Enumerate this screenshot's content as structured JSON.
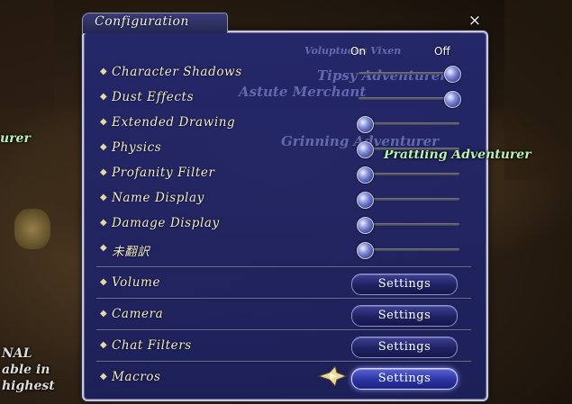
{
  "window": {
    "title": "Configuration",
    "close_glyph": "×"
  },
  "columns": {
    "on": "On",
    "off": "Off"
  },
  "background_text": {
    "green_left": "urer",
    "green_right": "Prattling Adventurer",
    "white_lines": [
      "NAL",
      "able in",
      "highest"
    ],
    "ghost_names": [
      "Voluptuous Vixen",
      "Tipsy Adventurer",
      "Astute Merchant",
      "Grinning Adventurer"
    ]
  },
  "toggles": [
    {
      "label": "Character Shadows",
      "value": "Off"
    },
    {
      "label": "Dust Effects",
      "value": "Off"
    },
    {
      "label": "Extended Drawing",
      "value": "On"
    },
    {
      "label": "Physics",
      "value": "On"
    },
    {
      "label": "Profanity Filter",
      "value": "On"
    },
    {
      "label": "Name Display",
      "value": "On"
    },
    {
      "label": "Damage Display",
      "value": "On"
    },
    {
      "label": "未翻訳",
      "value": "On"
    }
  ],
  "settings_rows": [
    {
      "label": "Volume",
      "button": "Settings"
    },
    {
      "label": "Camera",
      "button": "Settings"
    },
    {
      "label": "Chat Filters",
      "button": "Settings"
    },
    {
      "label": "Macros",
      "button": "Settings",
      "active": true
    }
  ],
  "colors": {
    "window_bg": "#24286e",
    "label_text": "#f2ead0",
    "active_button": "#2b34a0"
  }
}
